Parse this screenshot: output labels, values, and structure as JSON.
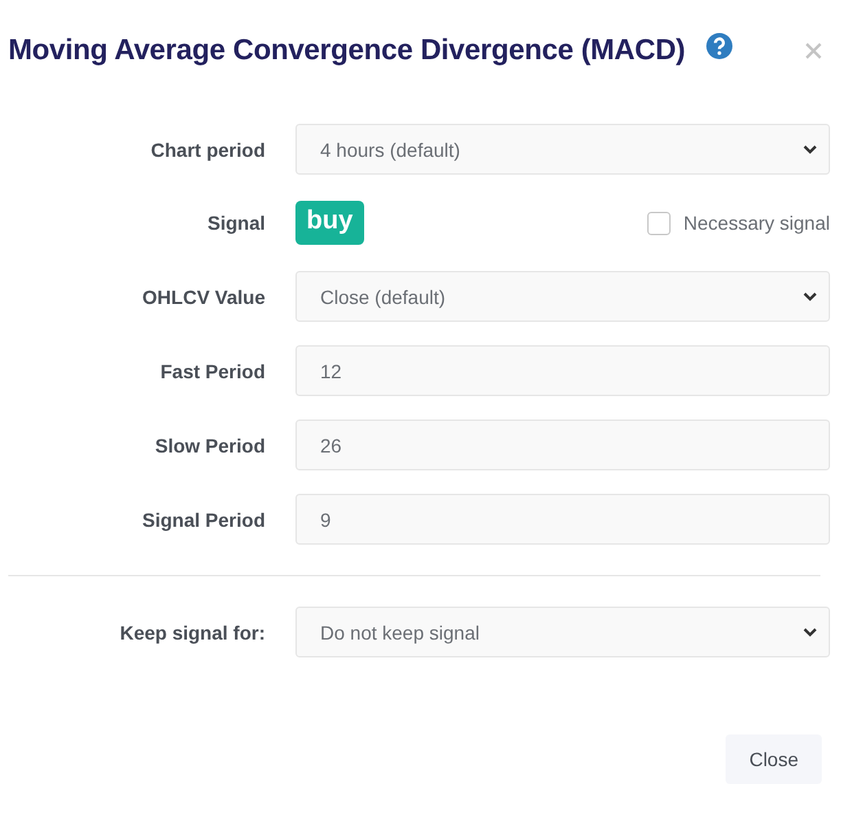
{
  "dialog": {
    "title": "Moving Average Convergence Divergence (MACD)"
  },
  "rows": [
    {
      "kind": "select",
      "label": "Chart period",
      "value": "4 hours (default)"
    },
    {
      "kind": "signal",
      "label": "Signal",
      "badge": "buy",
      "color": "#17b398",
      "checkbox_label": "Necessary signal",
      "checked": false
    },
    {
      "kind": "select",
      "label": "OHLCV Value",
      "value": "Close (default)"
    },
    {
      "kind": "input",
      "label": "Fast Period",
      "value": "12"
    },
    {
      "kind": "input",
      "label": "Slow Period",
      "value": "26"
    },
    {
      "kind": "input",
      "label": "Signal Period",
      "value": "9"
    }
  ],
  "keep": {
    "label": "Keep signal for:",
    "value": "Do not keep signal"
  },
  "buttons": [
    "Close"
  ]
}
